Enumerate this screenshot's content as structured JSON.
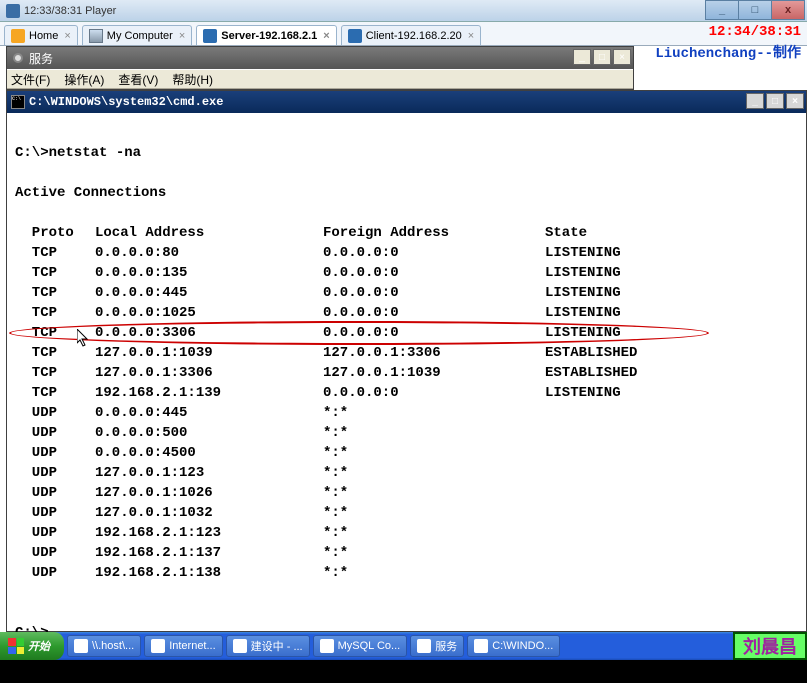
{
  "player": {
    "title": "12:33/38:31 Player"
  },
  "winbuttons": {
    "min": "_",
    "max": "□",
    "close": "x"
  },
  "tabs": [
    {
      "label": "Home",
      "active": false,
      "icon": "home"
    },
    {
      "label": "My Computer",
      "active": false,
      "icon": "pc"
    },
    {
      "label": "Server-192.168.2.1",
      "active": true,
      "icon": "srv"
    },
    {
      "label": "Client-192.168.2.20",
      "active": false,
      "icon": "srv"
    }
  ],
  "overlay": {
    "time": "12:34/38:31",
    "author": "Liuchenchang--制作"
  },
  "services": {
    "title": "服务",
    "menus": [
      "文件(F)",
      "操作(A)",
      "查看(V)",
      "帮助(H)"
    ]
  },
  "cmd": {
    "title": "C:\\WINDOWS\\system32\\cmd.exe",
    "prompt1": "C:\\>netstat -na",
    "heading": "Active Connections",
    "cols": {
      "proto": "Proto",
      "local": "Local Address",
      "foreign": "Foreign Address",
      "state": "State"
    },
    "rows": [
      {
        "proto": "TCP",
        "local": "0.0.0.0:80",
        "foreign": "0.0.0.0:0",
        "state": "LISTENING",
        "hl": false
      },
      {
        "proto": "TCP",
        "local": "0.0.0.0:135",
        "foreign": "0.0.0.0:0",
        "state": "LISTENING",
        "hl": false
      },
      {
        "proto": "TCP",
        "local": "0.0.0.0:445",
        "foreign": "0.0.0.0:0",
        "state": "LISTENING",
        "hl": false
      },
      {
        "proto": "TCP",
        "local": "0.0.0.0:1025",
        "foreign": "0.0.0.0:0",
        "state": "LISTENING",
        "hl": false
      },
      {
        "proto": "TCP",
        "local": "0.0.0.0:3306",
        "foreign": "0.0.0.0:0",
        "state": "LISTENING",
        "hl": true
      },
      {
        "proto": "TCP",
        "local": "127.0.0.1:1039",
        "foreign": "127.0.0.1:3306",
        "state": "ESTABLISHED",
        "hl": false
      },
      {
        "proto": "TCP",
        "local": "127.0.0.1:3306",
        "foreign": "127.0.0.1:1039",
        "state": "ESTABLISHED",
        "hl": false
      },
      {
        "proto": "TCP",
        "local": "192.168.2.1:139",
        "foreign": "0.0.0.0:0",
        "state": "LISTENING",
        "hl": false
      },
      {
        "proto": "UDP",
        "local": "0.0.0.0:445",
        "foreign": "*:*",
        "state": "",
        "hl": false
      },
      {
        "proto": "UDP",
        "local": "0.0.0.0:500",
        "foreign": "*:*",
        "state": "",
        "hl": false
      },
      {
        "proto": "UDP",
        "local": "0.0.0.0:4500",
        "foreign": "*:*",
        "state": "",
        "hl": false
      },
      {
        "proto": "UDP",
        "local": "127.0.0.1:123",
        "foreign": "*:*",
        "state": "",
        "hl": false
      },
      {
        "proto": "UDP",
        "local": "127.0.0.1:1026",
        "foreign": "*:*",
        "state": "",
        "hl": false
      },
      {
        "proto": "UDP",
        "local": "127.0.0.1:1032",
        "foreign": "*:*",
        "state": "",
        "hl": false
      },
      {
        "proto": "UDP",
        "local": "192.168.2.1:123",
        "foreign": "*:*",
        "state": "",
        "hl": false
      },
      {
        "proto": "UDP",
        "local": "192.168.2.1:137",
        "foreign": "*:*",
        "state": "",
        "hl": false
      },
      {
        "proto": "UDP",
        "local": "192.168.2.1:138",
        "foreign": "*:*",
        "state": "",
        "hl": false
      }
    ],
    "prompt2": "C:\\>"
  },
  "taskbar": {
    "start": "开始",
    "buttons": [
      "\\\\.host\\...",
      "Internet...",
      "建设中 - ...",
      "MySQL Co...",
      "服务",
      "C:\\WINDO..."
    ]
  },
  "signature": "刘晨昌"
}
